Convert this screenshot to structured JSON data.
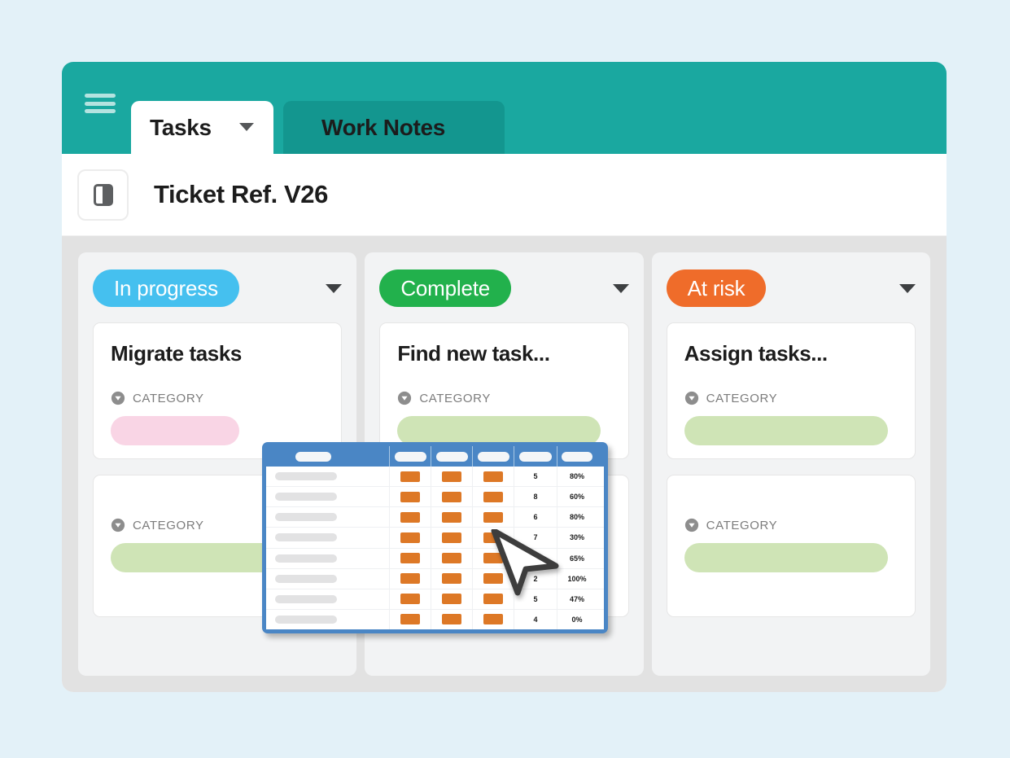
{
  "topbar": {
    "menu_icon": "hamburger-icon",
    "tabs": [
      {
        "label": "Tasks",
        "active": true,
        "caret": "chevron-down-icon"
      },
      {
        "label": "Work Notes",
        "active": false
      }
    ]
  },
  "subheader": {
    "panel_icon": "panel-toggle-icon",
    "title": "Ticket Ref. V26"
  },
  "board": {
    "columns": [
      {
        "status": "In progress",
        "status_color": "#45c0ef",
        "caret": "chevron-down-icon",
        "cards": [
          {
            "title": "Migrate tasks",
            "category_label": "CATEGORY",
            "category_color": "#f9d5e5"
          },
          {
            "title": "",
            "category_label": "CATEGORY",
            "category_color": "#cfe4b6"
          }
        ]
      },
      {
        "status": "Complete",
        "status_color": "#22b14c",
        "caret": "chevron-down-icon",
        "cards": [
          {
            "title": "Find new task...",
            "category_label": "CATEGORY",
            "category_color": "#cfe4b6"
          },
          {
            "title": "",
            "category_label": "CATEGORY",
            "category_color": "#cfe4b6"
          }
        ]
      },
      {
        "status": "At risk",
        "status_color": "#ef6c2a",
        "caret": "chevron-down-icon",
        "cards": [
          {
            "title": "Assign tasks...",
            "category_label": "CATEGORY",
            "category_color": "#cfe4b6"
          },
          {
            "title": "",
            "category_label": "CATEGORY",
            "category_color": "#cfe4b6"
          }
        ]
      }
    ]
  },
  "table_overlay": {
    "frame_color": "#4a86c5",
    "mark_color": "#dd7826",
    "header_cells": [
      "",
      "",
      "",
      "",
      "",
      ""
    ],
    "rows": [
      {
        "name": "",
        "m1": true,
        "m2": true,
        "m3": true,
        "num": "5",
        "pct": "80%"
      },
      {
        "name": "",
        "m1": true,
        "m2": true,
        "m3": true,
        "num": "8",
        "pct": "60%"
      },
      {
        "name": "",
        "m1": true,
        "m2": true,
        "m3": true,
        "num": "6",
        "pct": "80%"
      },
      {
        "name": "",
        "m1": true,
        "m2": true,
        "m3": true,
        "num": "7",
        "pct": "30%"
      },
      {
        "name": "",
        "m1": true,
        "m2": true,
        "m3": true,
        "num": "",
        "pct": "65%"
      },
      {
        "name": "",
        "m1": true,
        "m2": true,
        "m3": true,
        "num": "2",
        "pct": "100%"
      },
      {
        "name": "",
        "m1": true,
        "m2": true,
        "m3": true,
        "num": "5",
        "pct": "47%"
      },
      {
        "name": "",
        "m1": true,
        "m2": true,
        "m3": true,
        "num": "4",
        "pct": "0%"
      }
    ],
    "cursor": "mouse-pointer-icon"
  }
}
